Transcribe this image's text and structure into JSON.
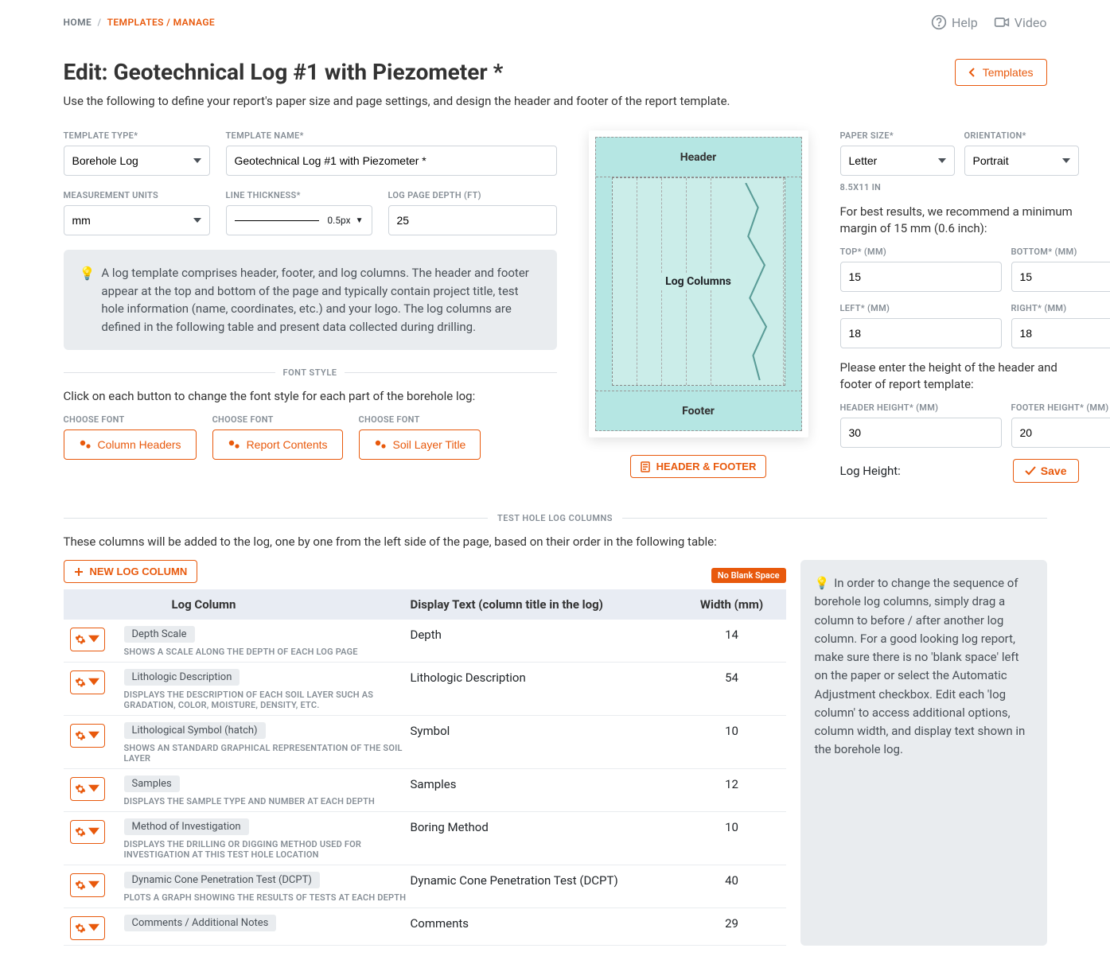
{
  "breadcrumb": {
    "home": "HOME",
    "templates": "TEMPLATES / MANAGE"
  },
  "help": {
    "help": "Help",
    "video": "Video"
  },
  "page": {
    "title": "Edit: Geotechnical Log #1 with Piezometer *",
    "subtitle": "Use the following to define your report's paper size and page settings, and design the header and footer of the report template.",
    "templates_btn": "Templates"
  },
  "form": {
    "template_type_label": "TEMPLATE TYPE*",
    "template_type": "Borehole Log",
    "template_name_label": "TEMPLATE NAME*",
    "template_name": "Geotechnical Log #1 with Piezometer *",
    "units_label": "MEASUREMENT UNITS",
    "units": "mm",
    "line_label": "LINE THICKNESS*",
    "line_value": "0.5px",
    "depth_label": "LOG PAGE DEPTH (FT)",
    "depth": "25",
    "tip": "A log template comprises header, footer, and log columns. The header and footer appear at the top and bottom of the page and typically contain project title, test hole information (name, coordinates, etc.) and your logo. The log columns are defined in the following table and present data collected during drilling."
  },
  "font": {
    "section": "FONT STYLE",
    "hint": "Click on each button to change the font style for each part of the borehole log:",
    "label": "CHOOSE FONT",
    "btn1": "Column Headers",
    "btn2": "Report Contents",
    "btn3": "Soil Layer Title"
  },
  "preview": {
    "header": "Header",
    "body": "Log Columns",
    "footer": "Footer",
    "hf_btn": "HEADER & FOOTER"
  },
  "sidebar": {
    "paper_label": "PAPER SIZE*",
    "paper": "Letter",
    "orient_label": "ORIENTATION*",
    "orient": "Portrait",
    "dims": "8.5X11 IN",
    "recommend": "For best results, we recommend a minimum margin of 15 mm (0.6 inch):",
    "top_label": "TOP* (MM)",
    "top": "15",
    "bottom_label": "BOTTOM* (MM)",
    "bottom": "15",
    "left_label": "LEFT* (MM)",
    "left": "18",
    "right_label": "RIGHT* (MM)",
    "right": "18",
    "heights_hint": "Please enter the height of the header and footer of report template:",
    "header_h_label": "HEADER HEIGHT* (MM)",
    "header_h": "30",
    "footer_h_label": "FOOTER HEIGHT* (MM)",
    "footer_h": "20",
    "log_height_label": "Log Height:",
    "save": "Save"
  },
  "cols": {
    "section": "TEST HOLE LOG COLUMNS",
    "intro": "These columns will be added to the log, one by one from the left side of the page, based on their order in the following table:",
    "new_btn": "NEW LOG COLUMN",
    "badge": "No Blank Space",
    "headers": {
      "col": "Log Column",
      "display": "Display Text (column title in the log)",
      "width": "Width (mm)"
    },
    "rows": [
      {
        "name": "Depth Scale",
        "desc": "SHOWS A SCALE ALONG THE DEPTH OF EACH LOG PAGE",
        "display": "Depth",
        "width": "14"
      },
      {
        "name": "Lithologic Description",
        "desc": "DISPLAYS THE DESCRIPTION OF EACH SOIL LAYER SUCH AS GRADATION, COLOR, MOISTURE, DENSITY, ETC.",
        "display": "Lithologic Description",
        "width": "54"
      },
      {
        "name": "Lithological Symbol (hatch)",
        "desc": "SHOWS AN STANDARD GRAPHICAL REPRESENTATION OF THE SOIL LAYER",
        "display": "Symbol",
        "width": "10"
      },
      {
        "name": "Samples",
        "desc": "DISPLAYS THE SAMPLE TYPE AND NUMBER AT EACH DEPTH",
        "display": "Samples",
        "width": "12"
      },
      {
        "name": "Method of Investigation",
        "desc": "DISPLAYS THE DRILLING OR DIGGING METHOD USED FOR INVESTIGATION AT THIS TEST HOLE LOCATION",
        "display": "Boring Method",
        "width": "10"
      },
      {
        "name": "Dynamic Cone Penetration Test (DCPT)",
        "desc": "PLOTS A GRAPH SHOWING THE RESULTS OF TESTS AT EACH DEPTH",
        "display": "Dynamic Cone Penetration Test (DCPT)",
        "width": "40"
      },
      {
        "name": "Comments / Additional Notes",
        "desc": "",
        "display": "Comments",
        "width": "29"
      }
    ],
    "side_tip": "In order to change the sequence of borehole log columns, simply drag a column to before / after another log column. For a good looking log report, make sure there is no 'blank space' left on the paper or select the Automatic Adjustment checkbox. Edit each 'log column' to access additional options, column width, and display text shown in the borehole log."
  }
}
